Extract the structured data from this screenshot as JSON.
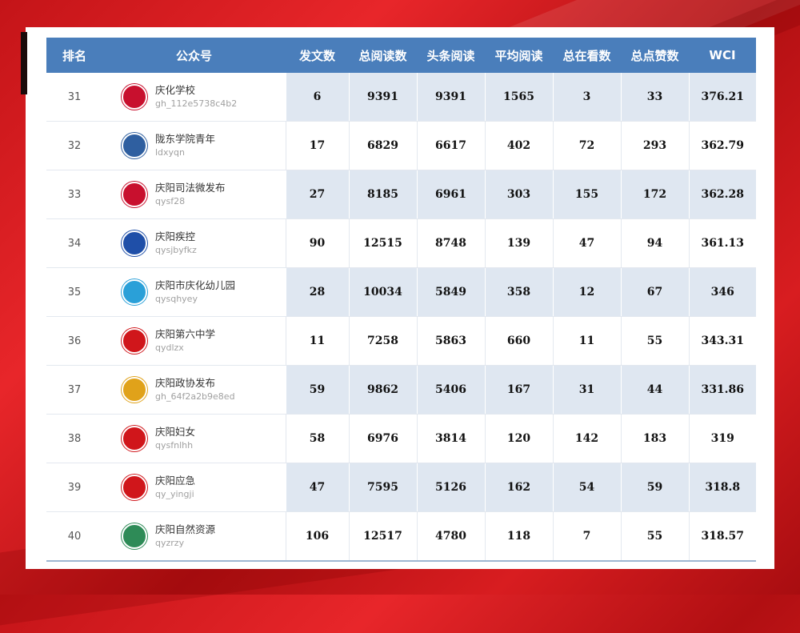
{
  "header": {
    "rank": "排名",
    "account": "公众号",
    "posts": "发文数",
    "total_reads": "总阅读数",
    "headline_reads": "头条阅读",
    "avg_reads": "平均阅读",
    "total_watching": "总在看数",
    "total_likes": "总点赞数",
    "wci": "WCI"
  },
  "rows": [
    {
      "rank": "31",
      "name": "庆化学校",
      "id": "gh_112e5738c4b2",
      "posts": "6",
      "total_reads": "9391",
      "headline_reads": "9391",
      "avg_reads": "1565",
      "watching": "3",
      "likes": "33",
      "wci": "376.21",
      "logo_icon": "school-emblem-icon",
      "logo_color": "#c8102e"
    },
    {
      "rank": "32",
      "name": "陇东学院青年",
      "id": "ldxyqn",
      "posts": "17",
      "total_reads": "6829",
      "headline_reads": "6617",
      "avg_reads": "402",
      "watching": "72",
      "likes": "293",
      "wci": "362.79",
      "logo_icon": "university-seal-icon",
      "logo_color": "#2f5fa0"
    },
    {
      "rank": "33",
      "name": "庆阳司法微发布",
      "id": "qysf28",
      "posts": "27",
      "total_reads": "8185",
      "headline_reads": "6961",
      "avg_reads": "303",
      "watching": "155",
      "likes": "172",
      "wci": "362.28",
      "logo_icon": "justice-badge-icon",
      "logo_color": "#c8102e"
    },
    {
      "rank": "34",
      "name": "庆阳疾控",
      "id": "qysjbyfkz",
      "posts": "90",
      "total_reads": "12515",
      "headline_reads": "8748",
      "avg_reads": "139",
      "watching": "47",
      "likes": "94",
      "wci": "361.13",
      "logo_icon": "cdc-logo-icon",
      "logo_color": "#1f4fa8"
    },
    {
      "rank": "35",
      "name": "庆阳市庆化幼儿园",
      "id": "qysqhyey",
      "posts": "28",
      "total_reads": "10034",
      "headline_reads": "5849",
      "avg_reads": "358",
      "watching": "12",
      "likes": "67",
      "wci": "346",
      "logo_icon": "kindergarten-logo-icon",
      "logo_color": "#2aa0d8"
    },
    {
      "rank": "36",
      "name": "庆阳第六中学",
      "id": "qydlzx",
      "posts": "11",
      "total_reads": "7258",
      "headline_reads": "5863",
      "avg_reads": "660",
      "watching": "11",
      "likes": "55",
      "wci": "343.31",
      "logo_icon": "school-seal-icon",
      "logo_color": "#d0161b"
    },
    {
      "rank": "37",
      "name": "庆阳政协发布",
      "id": "gh_64f2a2b9e8ed",
      "posts": "59",
      "total_reads": "9862",
      "headline_reads": "5406",
      "avg_reads": "167",
      "watching": "31",
      "likes": "44",
      "wci": "331.86",
      "logo_icon": "cppcc-emblem-icon",
      "logo_color": "#e0a21a"
    },
    {
      "rank": "38",
      "name": "庆阳妇女",
      "id": "qysfnlhh",
      "posts": "58",
      "total_reads": "6976",
      "headline_reads": "3814",
      "avg_reads": "120",
      "watching": "142",
      "likes": "183",
      "wci": "319",
      "logo_icon": "womens-federation-icon",
      "logo_color": "#d0161b"
    },
    {
      "rank": "39",
      "name": "庆阳应急",
      "id": "qy_yingji",
      "posts": "47",
      "total_reads": "7595",
      "headline_reads": "5126",
      "avg_reads": "162",
      "watching": "54",
      "likes": "59",
      "wci": "318.8",
      "logo_icon": "national-emblem-icon",
      "logo_color": "#d0161b"
    },
    {
      "rank": "40",
      "name": "庆阳自然资源",
      "id": "qyzrzy",
      "posts": "106",
      "total_reads": "12517",
      "headline_reads": "4780",
      "avg_reads": "118",
      "watching": "7",
      "likes": "55",
      "wci": "318.57",
      "logo_icon": "natural-resources-icon",
      "logo_color": "#2e8b57"
    }
  ]
}
